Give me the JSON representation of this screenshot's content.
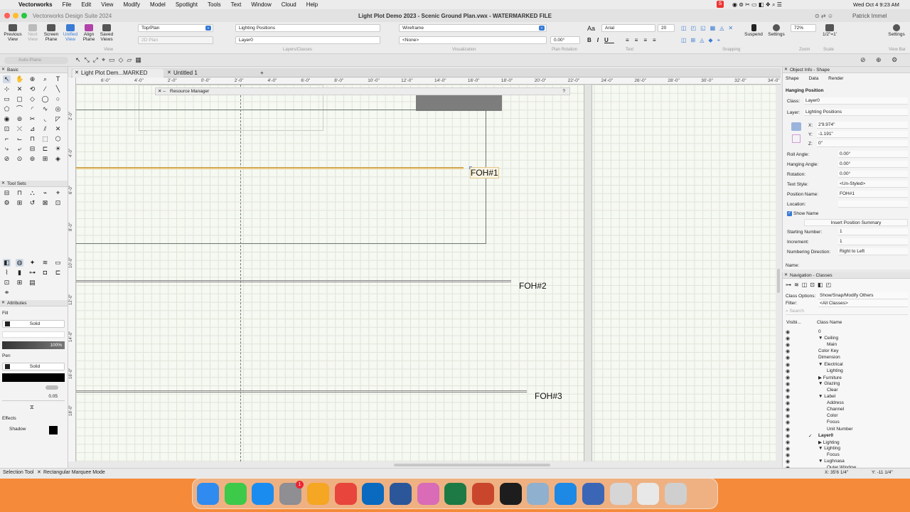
{
  "menubar": {
    "apple": "",
    "items": [
      "Vectorworks",
      "File",
      "Edit",
      "View",
      "Modify",
      "Model",
      "Spotlight",
      "Tools",
      "Text",
      "Window",
      "Cloud",
      "Help"
    ],
    "user": "Patrick Immel",
    "datetime": "Wed Oct 4  9:23 AM"
  },
  "window": {
    "app_name": "Vectorworks Design Suite 2024",
    "title": "Light Plot Demo 2023 - Scenic Ground Plan.vwx - WATERMARKED FILE"
  },
  "toolbar": {
    "previous_view": "Previous View",
    "next_view": "Next View",
    "screen_plane": "Screen Plane",
    "unified_view": "Unified View",
    "align_plane": "Align Plane",
    "saved_views": "Saved Views",
    "view_group": "View",
    "view_value": "Top/Plan",
    "plane_value": "2D Plan",
    "class_value": "Lighting Positions",
    "layer_value": "Layer0",
    "layers_group": "Layers/Classes",
    "render_value": "Wireframe",
    "projection_value": "<None>",
    "visualization_group": "Visualization",
    "plan_rotation_value": "0.00°",
    "plan_rotation_group": "Plan Rotation",
    "font_value": "Arial",
    "font_size": "20",
    "text_group": "Text",
    "suspend": "Suspend",
    "settings": "Settings",
    "snapping_group": "Snapping",
    "zoom_value": "72%",
    "zoom_group": "Zoom",
    "scale_value": "1/2\"=1'",
    "scale_group": "Scale",
    "viewbar_settings": "Settings",
    "viewbar_group": "View Bar",
    "auto_plane": "Auto-Plane"
  },
  "palettes": {
    "basic": "Basic",
    "tool_sets": "Tool Sets",
    "attributes": "Attributes",
    "fill_label": "Fill",
    "fill_style": "Solid",
    "opacity": "100%",
    "pen_label": "Pen",
    "pen_style": "Solid",
    "line_weight": "0.05",
    "effects": "Effects",
    "shadow": "Shadow"
  },
  "tabs": [
    "Light Plot Dem...MARKED FILE",
    "Untitled 1"
  ],
  "add_tab": "+",
  "ruler": {
    "h_labels": [
      "6'-0\"",
      "4'-0\"",
      "2'-0\"",
      "0'-0\"",
      "2'-0\"",
      "4'-0\"",
      "6'-0\"",
      "8'-0\"",
      "10'-0\"",
      "12'-0\"",
      "14'-0\"",
      "16'-0\"",
      "18'-0\"",
      "20'-0\"",
      "22'-0\"",
      "24'-0\"",
      "26'-0\"",
      "28'-0\"",
      "30'-0\"",
      "32'-0\"",
      "34'-0\"",
      "36"
    ],
    "v_labels": [
      "2'-0\"",
      "4'-0\"",
      "6'-0\"",
      "8'-0\"",
      "10'-0\"",
      "12'-0\"",
      "14'-0\"",
      "16'-0\"",
      "18'-0\""
    ]
  },
  "resource_manager": "Resource Manager",
  "positions": [
    "FOH#1",
    "FOH#2",
    "FOH#3"
  ],
  "object_info": {
    "title": "Object Info - Shape",
    "tabs": [
      "Shape",
      "Data",
      "Render"
    ],
    "object_type": "Hanging Position",
    "fields": [
      {
        "label": "Class:",
        "value": "Layer0"
      },
      {
        "label": "Layer:",
        "value": "Lighting Positions"
      },
      {
        "label": "X:",
        "value": "2'9.974\""
      },
      {
        "label": "Y:",
        "value": "-1.191\""
      },
      {
        "label": "Z:",
        "value": "0\""
      },
      {
        "label": "Roll Angle:",
        "value": "0.00°"
      },
      {
        "label": "Hanging Angle:",
        "value": "0.00°"
      },
      {
        "label": "Rotation:",
        "value": "0.00°"
      },
      {
        "label": "Text Style:",
        "value": "<Un-Styled>"
      },
      {
        "label": "Position Name:",
        "value": "FOH#1"
      },
      {
        "label": "Location:",
        "value": ""
      }
    ],
    "show_name": "Show Name",
    "insert_summary": "Insert Position Summary",
    "fields2": [
      {
        "label": "Starting Number:",
        "value": "1"
      },
      {
        "label": "Increment:",
        "value": "1"
      },
      {
        "label": "Numbering Direction:",
        "value": "Right to Left"
      }
    ],
    "name_label": "Name:"
  },
  "navigation": {
    "title": "Navigation - Classes",
    "class_options_label": "Class Options:",
    "class_options_value": "Show/Snap/Modify Others",
    "filter_label": "Filter:",
    "filter_value": "<All Classes>",
    "search_placeholder": "Search",
    "col_visibility": "Visibi...",
    "col_name": "Class Name",
    "classes": [
      {
        "name": "0",
        "indent": 0,
        "arrow": ""
      },
      {
        "name": "Ceiling",
        "indent": 0,
        "arrow": "▼"
      },
      {
        "name": "Main",
        "indent": 1,
        "arrow": ""
      },
      {
        "name": "Color Key",
        "indent": 0,
        "arrow": ""
      },
      {
        "name": "Dimension",
        "indent": 0,
        "arrow": ""
      },
      {
        "name": "Electrical",
        "indent": 0,
        "arrow": "▼"
      },
      {
        "name": "Lighting",
        "indent": 1,
        "arrow": ""
      },
      {
        "name": "Furniture",
        "indent": 0,
        "arrow": "▶"
      },
      {
        "name": "Glazing",
        "indent": 0,
        "arrow": "▼"
      },
      {
        "name": "Clear",
        "indent": 1,
        "arrow": ""
      },
      {
        "name": "Label",
        "indent": 0,
        "arrow": "▼"
      },
      {
        "name": "Address",
        "indent": 1,
        "arrow": ""
      },
      {
        "name": "Channel",
        "indent": 1,
        "arrow": ""
      },
      {
        "name": "Color",
        "indent": 1,
        "arrow": ""
      },
      {
        "name": "Focus",
        "indent": 1,
        "arrow": ""
      },
      {
        "name": "Unit Number",
        "indent": 1,
        "arrow": ""
      },
      {
        "name": "Layer0",
        "indent": 0,
        "arrow": "",
        "active": true
      },
      {
        "name": "Lighting",
        "indent": 0,
        "arrow": "▶"
      },
      {
        "name": "Lighting",
        "indent": 0,
        "arrow": "▼"
      },
      {
        "name": "Focus",
        "indent": 1,
        "arrow": ""
      },
      {
        "name": "Lughnasa",
        "indent": 0,
        "arrow": "▼"
      },
      {
        "name": "Outer Window",
        "indent": 1,
        "arrow": ""
      }
    ]
  },
  "status": {
    "tool": "Selection Tool",
    "mode": "Rectangular Marquee Mode",
    "x": "X: 35'6 1/4\"",
    "y": "Y: -11 1/4\""
  },
  "dock": {
    "apps": [
      "finder-icon",
      "messages-icon",
      "app-store-icon",
      "system-settings-icon",
      "launchpad-icon",
      "chrome-icon",
      "outlook-icon",
      "word-icon",
      "photos-icon",
      "excel-icon",
      "powerpoint-icon",
      "vectorworks-icon",
      "preview-icon",
      "safari-icon",
      "vectorworks-service-icon",
      "folder-icon",
      "downloads-icon",
      "trash-icon"
    ],
    "colors": [
      "#2f8bef",
      "#3dc94a",
      "#1a8cf0",
      "#8e8e93",
      "#f5a623",
      "#e8453c",
      "#0a6abf",
      "#2b579a",
      "#d96bb7",
      "#1d7a45",
      "#c9462c",
      "#1d1d1d",
      "#8fb0cf",
      "#1e88e5",
      "#3b66b5",
      "#d6d6d6",
      "#e8e8e8",
      "#cfcfcf"
    ],
    "badge": "1"
  }
}
